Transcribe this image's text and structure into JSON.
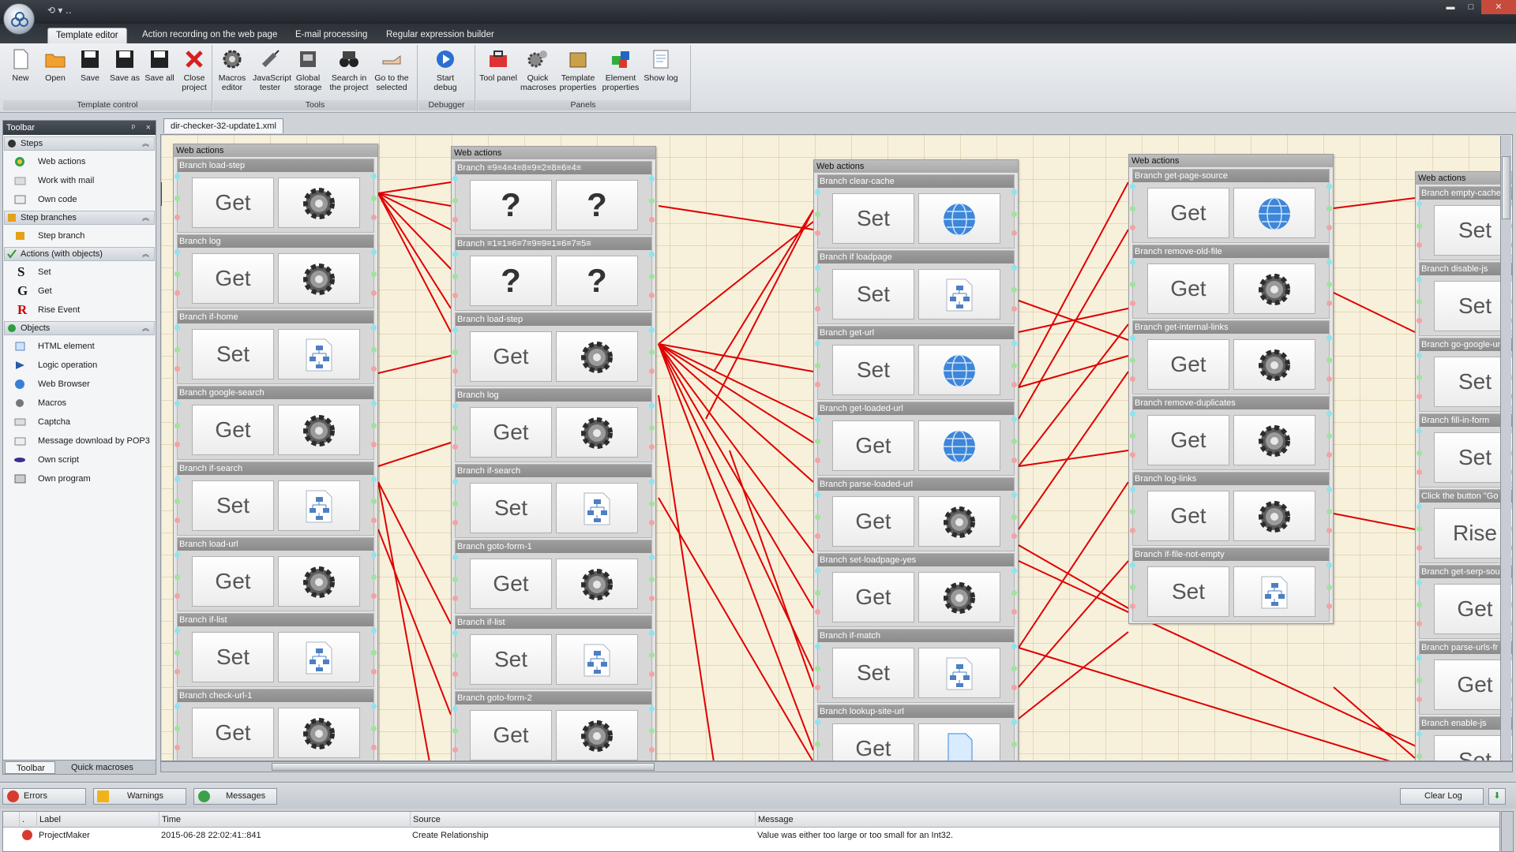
{
  "window": {
    "minimize": "▬",
    "maximize": "□",
    "close": "✕"
  },
  "ribbon": {
    "tabs": [
      "Template editor",
      "Action recording on the web page",
      "E-mail processing",
      "Regular expression builder"
    ],
    "groups": {
      "template_control": {
        "label": "Template control",
        "buttons": [
          "New",
          "Open",
          "Save",
          "Save as",
          "Save all",
          "Close project"
        ]
      },
      "tools": {
        "label": "Tools",
        "buttons": [
          "Macros editor",
          "JavaScript tester",
          "Global storage",
          "Search in the project",
          "Go to the selected"
        ]
      },
      "debugger": {
        "label": "Debugger",
        "buttons": [
          "Start debug"
        ]
      },
      "panels": {
        "label": "Panels",
        "buttons": [
          "Tool panel",
          "Quick macroses",
          "Template properties",
          "Element properties",
          "Show log"
        ]
      }
    }
  },
  "toolbar": {
    "title": "Toolbar",
    "pin": "ᵖ",
    "close": "×",
    "sections": [
      {
        "title": "Steps",
        "items": [
          "Web actions",
          "Work with mail",
          "Own code"
        ]
      },
      {
        "title": "Step branches",
        "items": [
          "Step branch"
        ]
      },
      {
        "title": "Actions (with objects)",
        "items": [
          "Set",
          "Get",
          "Rise Event"
        ],
        "letters": [
          "S",
          "G",
          "R"
        ]
      },
      {
        "title": "Objects",
        "items": [
          "HTML element",
          "Logic operation",
          "Web Browser",
          "Macros",
          "Captcha",
          "Message download by POP3",
          "Own script",
          "Own program"
        ]
      }
    ],
    "bottom_tabs": [
      "Toolbar",
      "Quick macroses"
    ]
  },
  "document_tab": "dir-checker-32-update1.xml",
  "canvas": {
    "columns": [
      {
        "head": "Web actions",
        "branches": [
          {
            "title": "Branch load-step",
            "action": "Get",
            "object": "gear"
          },
          {
            "title": "Branch log",
            "action": "Get",
            "object": "gear"
          },
          {
            "title": "Branch if-home",
            "action": "Set",
            "object": "logic"
          },
          {
            "title": "Branch google-search",
            "action": "Get",
            "object": "gear"
          },
          {
            "title": "Branch if-search",
            "action": "Set",
            "object": "logic"
          },
          {
            "title": "Branch load-url",
            "action": "Get",
            "object": "gear"
          },
          {
            "title": "Branch if-list",
            "action": "Set",
            "object": "logic"
          },
          {
            "title": "Branch check-url-1",
            "action": "Get",
            "object": "gear"
          }
        ]
      },
      {
        "head": "Web actions",
        "branches": [
          {
            "title": "Branch ≡9≡4≡4≡8≡9≡2≡8≡6≡4≡",
            "action": "?",
            "object": "question"
          },
          {
            "title": "Branch ≡1≡1≡6≡7≡9≡9≡1≡6≡7≡5≡",
            "action": "?",
            "object": "question"
          },
          {
            "title": "Branch load-step",
            "action": "Get",
            "object": "gear"
          },
          {
            "title": "Branch log",
            "action": "Get",
            "object": "gear"
          },
          {
            "title": "Branch if-search",
            "action": "Set",
            "object": "logic"
          },
          {
            "title": "Branch goto-form-1",
            "action": "Get",
            "object": "gear"
          },
          {
            "title": "Branch if-list",
            "action": "Set",
            "object": "logic"
          },
          {
            "title": "Branch goto-form-2",
            "action": "Get",
            "object": "gear"
          }
        ]
      },
      {
        "head": "Web actions",
        "branches": [
          {
            "title": "Branch clear-cache",
            "action": "Set",
            "object": "globe"
          },
          {
            "title": "Branch if loadpage",
            "action": "Set",
            "object": "logic"
          },
          {
            "title": "Branch get-url",
            "action": "Set",
            "object": "globe"
          },
          {
            "title": "Branch get-loaded-url",
            "action": "Get",
            "object": "globe"
          },
          {
            "title": "Branch parse-loaded-url",
            "action": "Get",
            "object": "gear"
          },
          {
            "title": "Branch set-loadpage-yes",
            "action": "Get",
            "object": "gear"
          },
          {
            "title": "Branch if-match",
            "action": "Set",
            "object": "logic"
          },
          {
            "title": "Branch lookup-site-url",
            "action": "Get",
            "object": "doc"
          }
        ]
      },
      {
        "head": "Web actions",
        "branches": [
          {
            "title": "Branch get-page-source",
            "action": "Get",
            "object": "globe"
          },
          {
            "title": "Branch remove-old-file",
            "action": "Get",
            "object": "gear"
          },
          {
            "title": "Branch get-internal-links",
            "action": "Get",
            "object": "gear"
          },
          {
            "title": "Branch remove-duplicates",
            "action": "Get",
            "object": "gear"
          },
          {
            "title": "Branch log-links",
            "action": "Get",
            "object": "gear"
          },
          {
            "title": "Branch if-file-not-empty",
            "action": "Set",
            "object": "logic"
          }
        ]
      },
      {
        "head": "Web actions",
        "branches": [
          {
            "title": "Branch empty-cache",
            "action": "Set",
            "object": ""
          },
          {
            "title": "Branch disable-js",
            "action": "Set",
            "object": ""
          },
          {
            "title": "Branch go-google-url",
            "action": "Set",
            "object": ""
          },
          {
            "title": "Branch fill-in-form",
            "action": "Set",
            "object": ""
          },
          {
            "title": "Click the button \"Go",
            "action": "Rise",
            "object": ""
          },
          {
            "title": "Branch get-serp-sou",
            "action": "Get",
            "object": ""
          },
          {
            "title": "Branch parse-urls-fr",
            "action": "Get",
            "object": ""
          },
          {
            "title": "Branch enable-js",
            "action": "Set",
            "object": ""
          }
        ]
      }
    ]
  },
  "log": {
    "buttons": [
      "Errors",
      "Warnings",
      "Messages"
    ],
    "clear": "Clear Log",
    "columns": [
      ".",
      "Label",
      "Time",
      "Source",
      "Message"
    ],
    "rows": [
      {
        "label": "ProjectMaker",
        "time": "2015-06-28   22:02:41::841",
        "source": "Create Relationship",
        "message": "Value was either too large or too small for an Int32."
      }
    ]
  },
  "colors": {
    "connector": "#e00000",
    "canvas": "#f7f1dc",
    "ribbon_dark": "#2d3238"
  }
}
